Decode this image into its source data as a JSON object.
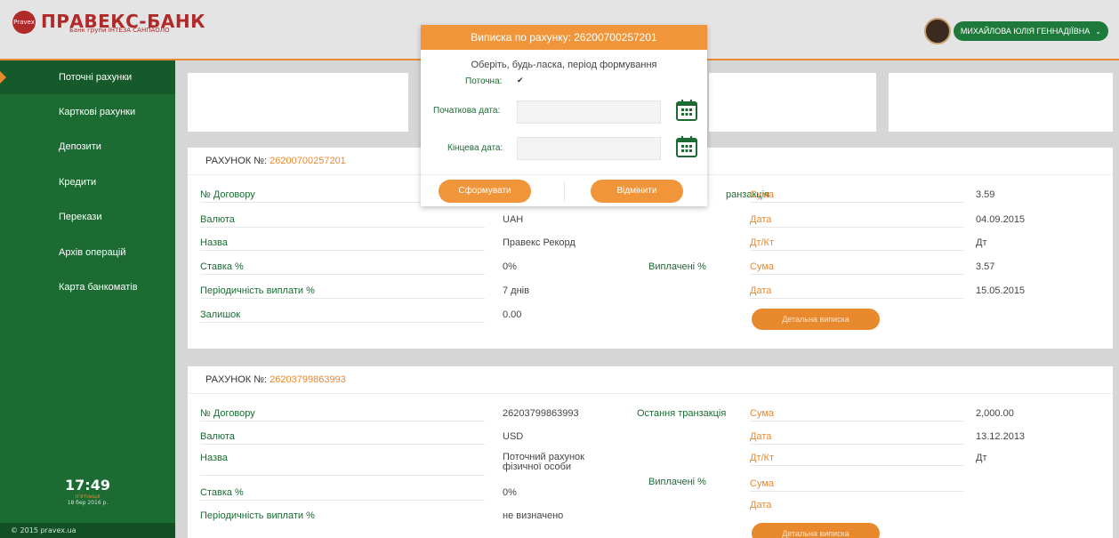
{
  "header": {
    "logo_mark": "Pravex",
    "bank_name": "ПРАВЕКС-БАНК",
    "bank_sub": "Банк групи ІНТЕЗА САНПАОЛО",
    "user_name": "МИХАЙЛОВА ЮЛІЯ ГЕННАДІЇВНА"
  },
  "sidebar": {
    "items": [
      {
        "label": "Поточні рахунки"
      },
      {
        "label": "Карткові рахунки"
      },
      {
        "label": "Депозити"
      },
      {
        "label": "Кредити"
      },
      {
        "label": "Перекази"
      },
      {
        "label": "Архів операцій"
      },
      {
        "label": "Карта банкоматів"
      }
    ],
    "clock": {
      "time": "17:49",
      "weekday": "п'ятниця",
      "date": "18 бер 2016 р."
    },
    "footer": "© 2015 pravex.ua"
  },
  "account1": {
    "title_prefix": "РАХУНОК №:",
    "number": "26200700257201",
    "rows": {
      "contract_label": "№ Договору",
      "currency_label": "Валюта",
      "currency_value": "UAH",
      "name_label": "Назва",
      "name_value": "Правекс Рекорд",
      "rate_label": "Ставка %",
      "rate_value": "0%",
      "period_label": "Періодичність виплати %",
      "period_value": "7 днів",
      "balance_label": "Залишок",
      "balance_value": "0.00"
    },
    "last_tx": {
      "label_fragment": "ранзакція",
      "sum_label": "Сума",
      "sum_value": "3.59",
      "date_label": "Дата",
      "date_value": "04.09.2015",
      "drcr_label": "Дт/Кт",
      "drcr_value": "Дт"
    },
    "paid": {
      "label": "Виплачені %",
      "sum_label": "Сума",
      "sum_value": "3.57",
      "date_label": "Дата",
      "date_value": "15.05.2015"
    },
    "detail_button": "Детальна виписка"
  },
  "account2": {
    "title_prefix": "РАХУНОК №:",
    "number": "26203799863993",
    "rows": {
      "contract_label": "№ Договору",
      "contract_value": "26203799863993",
      "currency_label": "Валюта",
      "currency_value": "USD",
      "name_label": "Назва",
      "name_value_1": "Поточний рахунок",
      "name_value_2": "фізичної особи",
      "rate_label": "Ставка %",
      "rate_value": "0%",
      "period_label": "Періодичність виплати %",
      "period_value": "не визначено"
    },
    "last_tx": {
      "label": "Остання транзакція",
      "sum_label": "Сума",
      "sum_value": "2,000.00",
      "date_label": "Дата",
      "date_value": "13.12.2013",
      "drcr_label": "Дт/Кт",
      "drcr_value": "Дт"
    },
    "paid": {
      "label": "Виплачені %",
      "sum_label": "Сума",
      "date_label": "Дата"
    },
    "detail_button": "Детальна виписка"
  },
  "modal": {
    "title": "Виписка по рахунку: 26200700257201",
    "subtitle": "Оберіть, будь-ласка, період формування",
    "current_label": "Поточна:",
    "current_checked": true,
    "start_label": "Початкова дата:",
    "start_value": "",
    "end_label": "Кінцева дата:",
    "end_value": "",
    "submit_label": "Сформувати",
    "cancel_label": "Відмінити",
    "calendar_icon": "calendar-icon"
  },
  "colors": {
    "green": "#1b6b33",
    "orange": "#e8892e",
    "header_orange": "#f0953a"
  }
}
